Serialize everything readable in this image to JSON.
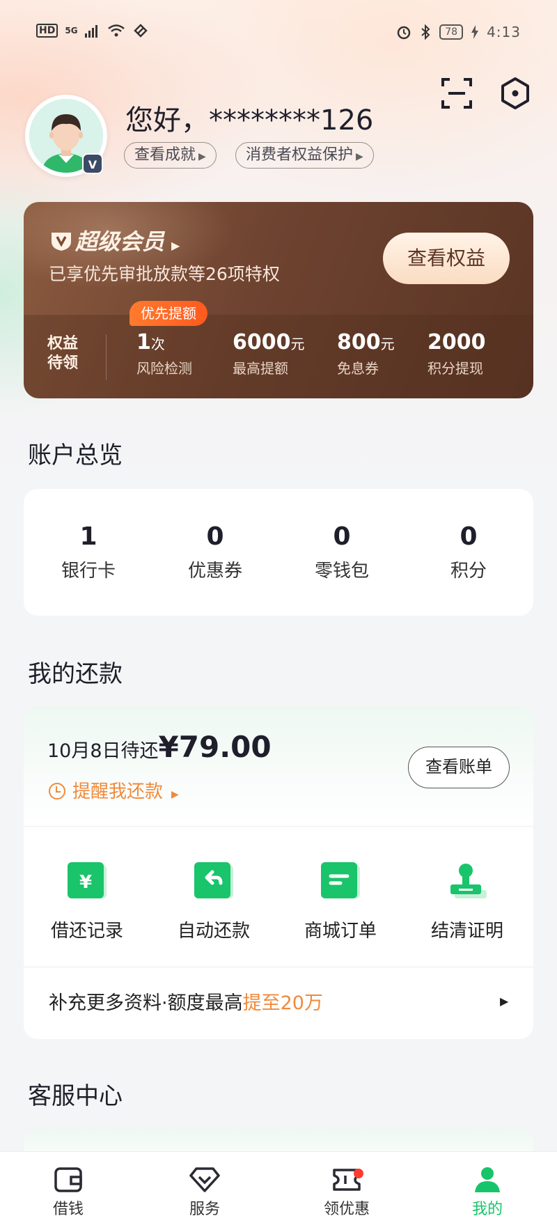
{
  "status_bar": {
    "network": "HD",
    "signal": "5G",
    "battery": "78",
    "time": "4:13"
  },
  "header": {
    "greeting": "您好，********126",
    "pill_achievement": "查看成就",
    "pill_rights": "消费者权益保护",
    "badge": "V"
  },
  "member": {
    "title": "超级会员",
    "subtitle": "已享优先审批放款等26项特权",
    "button": "查看权益",
    "tag": "优先提额",
    "label": "权益待领",
    "stats": [
      {
        "value": "1",
        "unit": "次",
        "label": "风险检测"
      },
      {
        "value": "6000",
        "unit": "元",
        "label": "最高提额"
      },
      {
        "value": "800",
        "unit": "元",
        "label": "免息券"
      },
      {
        "value": "2000",
        "unit": "",
        "label": "积分提现"
      }
    ]
  },
  "overview": {
    "title": "账户总览",
    "items": [
      {
        "count": "1",
        "label": "银行卡"
      },
      {
        "count": "0",
        "label": "优惠券"
      },
      {
        "count": "0",
        "label": "零钱包"
      },
      {
        "count": "0",
        "label": "积分"
      }
    ]
  },
  "repayment": {
    "title": "我的还款",
    "due_prefix": "10月8日待还",
    "due_amount": "¥79.00",
    "remind": "提醒我还款",
    "bill_button": "查看账单",
    "quick": [
      {
        "label": "借还记录",
        "icon": "yen-doc-icon"
      },
      {
        "label": "自动还款",
        "icon": "return-arrow-icon"
      },
      {
        "label": "商城订单",
        "icon": "order-doc-icon"
      },
      {
        "label": "结清证明",
        "icon": "stamp-icon"
      }
    ],
    "more_text": "补充更多资料·额度最高",
    "more_highlight": "提至20万"
  },
  "service": {
    "title": "客服中心"
  },
  "nav": [
    {
      "label": "借钱",
      "icon": "wallet-icon"
    },
    {
      "label": "服务",
      "icon": "diamond-icon"
    },
    {
      "label": "领优惠",
      "icon": "ticket-icon"
    },
    {
      "label": "我的",
      "icon": "person-icon"
    }
  ],
  "colors": {
    "accent_green": "#18c46a",
    "accent_orange": "#f08a3c",
    "member_brown": "#6e4330"
  }
}
